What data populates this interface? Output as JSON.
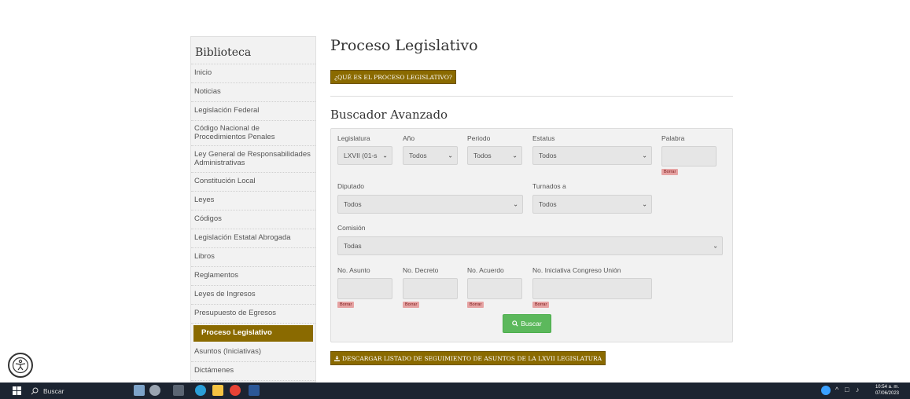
{
  "sidebar": {
    "title": "Biblioteca",
    "items": [
      {
        "label": "Inicio"
      },
      {
        "label": "Noticias"
      },
      {
        "label": "Legislación Federal"
      },
      {
        "label": "Código Nacional de Procedimientos Penales"
      },
      {
        "label": "Ley General de Responsabilidades Administrativas"
      },
      {
        "label": "Constitución Local"
      },
      {
        "label": "Leyes"
      },
      {
        "label": "Códigos"
      },
      {
        "label": "Legislación Estatal Abrogada"
      },
      {
        "label": "Libros"
      },
      {
        "label": "Reglamentos"
      },
      {
        "label": "Leyes de Ingresos"
      },
      {
        "label": "Presupuesto de Egresos"
      },
      {
        "label": "Proceso Legislativo"
      },
      {
        "label": "Asuntos (Iniciativas)"
      },
      {
        "label": "Dictámenes"
      }
    ],
    "active_index": 13
  },
  "main": {
    "title": "Proceso Legislativo",
    "que_es_button": "¿QUÉ ES EL PROCESO LEGISLATIVO?",
    "search_title": "Buscador Avanzado",
    "download_button": "DESCARGAR LISTADO DE SEGUIMIENTO DE ASUNTOS DE LA LXVII LEGISLATURA"
  },
  "search": {
    "legislatura": {
      "label": "Legislatura",
      "value": "LXVII (01-s"
    },
    "anio": {
      "label": "Año",
      "value": "Todos"
    },
    "periodo": {
      "label": "Periodo",
      "value": "Todos"
    },
    "estatus": {
      "label": "Estatus",
      "value": "Todos"
    },
    "palabra": {
      "label": "Palabra",
      "value": ""
    },
    "diputado": {
      "label": "Diputado",
      "value": "Todos"
    },
    "turnados": {
      "label": "Turnados a",
      "value": "Todos"
    },
    "comision": {
      "label": "Comisión",
      "value": "Todas"
    },
    "no_asunto": {
      "label": "No. Asunto",
      "value": ""
    },
    "no_decreto": {
      "label": "No. Decreto",
      "value": ""
    },
    "no_acuerdo": {
      "label": "No. Acuerdo",
      "value": ""
    },
    "no_iniciativa": {
      "label": "No. Iniciativa Congreso Unión",
      "value": ""
    },
    "borrar_label": "Borrar",
    "buscar_label": "Buscar"
  },
  "taskbar": {
    "search_placeholder": "Buscar",
    "time": "10:54 a. m.",
    "date": "07/06/2023"
  },
  "colors": {
    "accent_gold": "#8a6a00",
    "buscar_green": "#5cb85c",
    "borrar_red": "#e6a3a3",
    "taskbar": "#1c2431"
  }
}
